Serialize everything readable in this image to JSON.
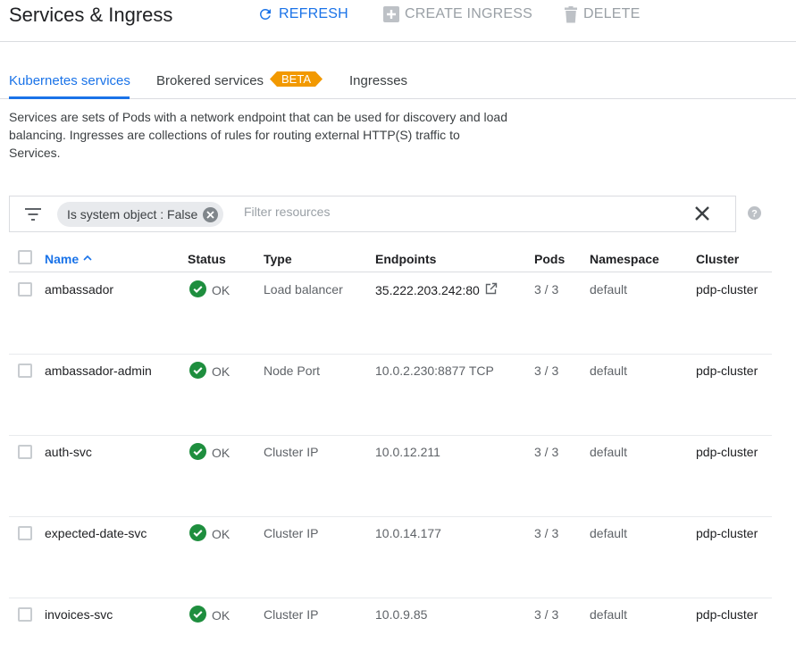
{
  "header": {
    "title": "Services & Ingress",
    "refresh_label": "REFRESH",
    "create_label": "CREATE INGRESS",
    "delete_label": "DELETE"
  },
  "tabs": [
    {
      "label": "Kubernetes services",
      "active": true
    },
    {
      "label": "Brokered services",
      "badge": "BETA"
    },
    {
      "label": "Ingresses"
    }
  ],
  "description": "Services are sets of Pods with a network endpoint that can be used for discovery and load balancing. Ingresses are collections of rules for routing external HTTP(S) traffic to Services.",
  "filter": {
    "chip_label": "Is system object : False",
    "placeholder": "Filter resources"
  },
  "table": {
    "columns": {
      "name": "Name",
      "status": "Status",
      "type": "Type",
      "endpoints": "Endpoints",
      "pods": "Pods",
      "namespace": "Namespace",
      "cluster": "Cluster"
    },
    "rows": [
      {
        "name": "ambassador",
        "status": "OK",
        "type": "Load balancer",
        "endpoint": "35.222.203.242:80",
        "external": true,
        "pods": "3 / 3",
        "namespace": "default",
        "cluster": "pdp-cluster"
      },
      {
        "name": "ambassador-admin",
        "status": "OK",
        "type": "Node Port",
        "endpoint": "10.0.2.230:8877 TCP",
        "external": false,
        "pods": "3 / 3",
        "namespace": "default",
        "cluster": "pdp-cluster"
      },
      {
        "name": "auth-svc",
        "status": "OK",
        "type": "Cluster IP",
        "endpoint": "10.0.12.211",
        "external": false,
        "pods": "3 / 3",
        "namespace": "default",
        "cluster": "pdp-cluster"
      },
      {
        "name": "expected-date-svc",
        "status": "OK",
        "type": "Cluster IP",
        "endpoint": "10.0.14.177",
        "external": false,
        "pods": "3 / 3",
        "namespace": "default",
        "cluster": "pdp-cluster"
      },
      {
        "name": "invoices-svc",
        "status": "OK",
        "type": "Cluster IP",
        "endpoint": "10.0.9.85",
        "external": false,
        "pods": "3 / 3",
        "namespace": "default",
        "cluster": "pdp-cluster"
      }
    ]
  },
  "colors": {
    "accent": "#1a73e8",
    "ok": "#1e8e3e",
    "beta": "#f29900",
    "disabled": "#9aa0a6"
  }
}
